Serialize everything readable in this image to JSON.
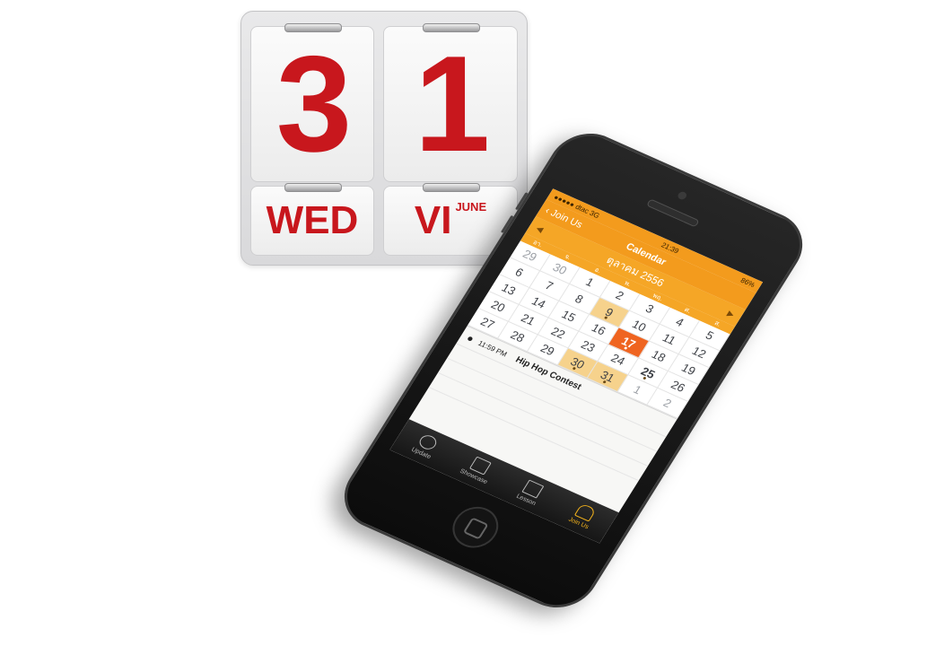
{
  "flip_calendar": {
    "day_digits": [
      "3",
      "1"
    ],
    "weekday": "WED",
    "month_roman": "VI",
    "month_name": "JUNE"
  },
  "phone": {
    "status": {
      "carrier": "●●●●● dtac 3G",
      "time": "21:39",
      "battery": "86%"
    },
    "nav": {
      "back_label": "Join Us",
      "title": "Calendar"
    },
    "calendar": {
      "month_label": "ตุลาคม 2556",
      "weekdays": [
        "อา.",
        "จ.",
        "อ.",
        "พ.",
        "พฤ.",
        "ศ.",
        "ส."
      ],
      "days": [
        {
          "d": "29",
          "state": "muted"
        },
        {
          "d": "30",
          "state": "muted"
        },
        {
          "d": "1",
          "state": ""
        },
        {
          "d": "2",
          "state": ""
        },
        {
          "d": "3",
          "state": ""
        },
        {
          "d": "4",
          "state": ""
        },
        {
          "d": "5",
          "state": ""
        },
        {
          "d": "6",
          "state": ""
        },
        {
          "d": "7",
          "state": ""
        },
        {
          "d": "8",
          "state": ""
        },
        {
          "d": "9",
          "state": "event"
        },
        {
          "d": "10",
          "state": ""
        },
        {
          "d": "11",
          "state": ""
        },
        {
          "d": "12",
          "state": ""
        },
        {
          "d": "13",
          "state": ""
        },
        {
          "d": "14",
          "state": ""
        },
        {
          "d": "15",
          "state": ""
        },
        {
          "d": "16",
          "state": ""
        },
        {
          "d": "17",
          "state": "today"
        },
        {
          "d": "18",
          "state": ""
        },
        {
          "d": "19",
          "state": ""
        },
        {
          "d": "20",
          "state": ""
        },
        {
          "d": "21",
          "state": ""
        },
        {
          "d": "22",
          "state": ""
        },
        {
          "d": "23",
          "state": ""
        },
        {
          "d": "24",
          "state": ""
        },
        {
          "d": "25",
          "state": "bold"
        },
        {
          "d": "26",
          "state": ""
        },
        {
          "d": "27",
          "state": ""
        },
        {
          "d": "28",
          "state": ""
        },
        {
          "d": "29",
          "state": ""
        },
        {
          "d": "30",
          "state": "event"
        },
        {
          "d": "31",
          "state": "event"
        },
        {
          "d": "1",
          "state": "muted"
        },
        {
          "d": "2",
          "state": "muted"
        }
      ]
    },
    "events": [
      {
        "time": "11:59 PM",
        "title": "Hip Hop Contest"
      }
    ],
    "tabs": [
      {
        "label": "Update",
        "icon": "clock-icon",
        "active": false
      },
      {
        "label": "Showcase",
        "icon": "folder-icon",
        "active": false
      },
      {
        "label": "Lesson",
        "icon": "book-icon",
        "active": false
      },
      {
        "label": "Join Us",
        "icon": "people-icon",
        "active": true
      }
    ]
  },
  "colors": {
    "calendar_red": "#c8171d",
    "app_orange": "#f39b1d",
    "today": "#ef6420",
    "event_fill": "#f6d28c"
  }
}
